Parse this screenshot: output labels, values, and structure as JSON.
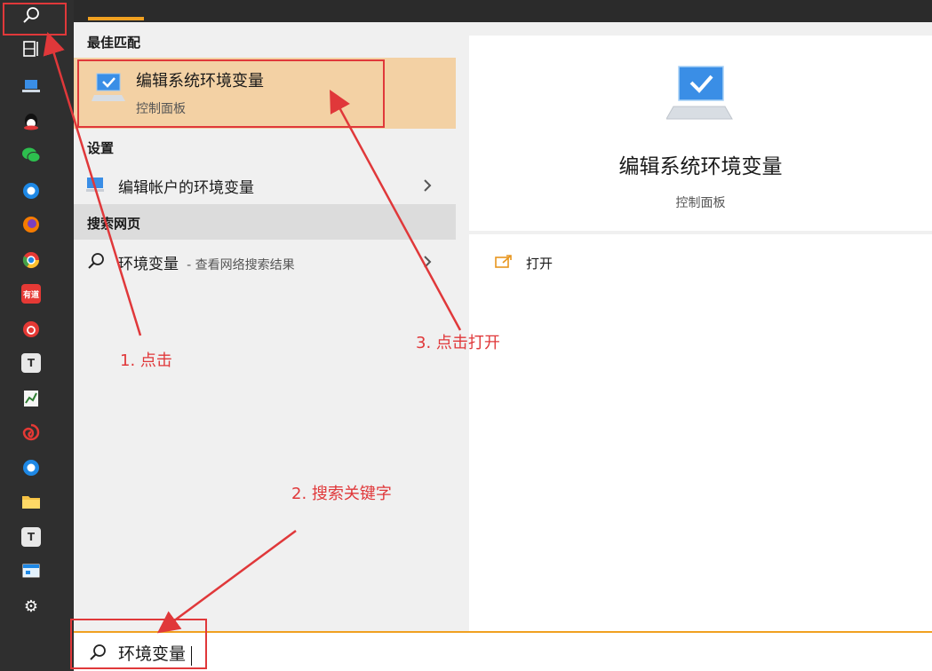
{
  "search": {
    "query": "环境变量"
  },
  "results": {
    "best_match_header": "最佳匹配",
    "best_match": {
      "title": "编辑系统环境变量",
      "subtitle": "控制面板"
    },
    "settings_header": "设置",
    "settings_item": {
      "label": "编辑帐户的环境变量"
    },
    "web_header": "搜索网页",
    "web_item": {
      "query": "环境变量",
      "suffix": "- 查看网络搜索结果"
    }
  },
  "preview": {
    "title": "编辑系统环境变量",
    "subtitle": "控制面板",
    "open_label": "打开"
  },
  "annotations": {
    "step1": "1. 点击",
    "step2": "2. 搜索关键字",
    "step3": "3. 点击打开"
  },
  "colors": {
    "accent": "#f0a020",
    "highlight": "#f3d1a4",
    "annotation_red": "#e0383a",
    "rail_bg": "#2f2f2f"
  },
  "rail_icons": [
    "search-icon",
    "task-view-icon",
    "laptop-icon",
    "qq-icon",
    "wechat-icon",
    "browser-icon",
    "firefox-icon",
    "chrome-icon",
    "youdao-icon",
    "netease-music-icon",
    "typora-icon",
    "chart-app-icon",
    "swirl-app-icon",
    "browser-icon-2",
    "folder-icon",
    "typora-icon-2",
    "window-app-icon",
    "settings-gear-icon"
  ]
}
